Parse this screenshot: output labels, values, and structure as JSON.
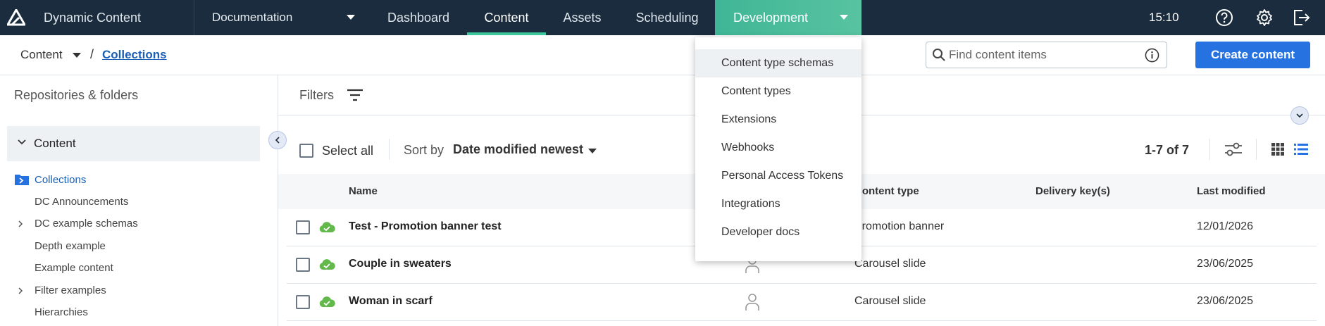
{
  "app": {
    "title": "Dynamic Content",
    "hub": "Documentation",
    "time": "15:10"
  },
  "nav": {
    "tabs": [
      {
        "label": "Dashboard"
      },
      {
        "label": "Content"
      },
      {
        "label": "Assets"
      },
      {
        "label": "Scheduling"
      }
    ],
    "active": "Content",
    "development": "Development"
  },
  "development_menu": {
    "items": [
      {
        "label": "Content type schemas"
      },
      {
        "label": "Content types"
      },
      {
        "label": "Extensions"
      },
      {
        "label": "Webhooks"
      },
      {
        "label": "Personal Access Tokens"
      },
      {
        "label": "Integrations"
      },
      {
        "label": "Developer docs"
      }
    ],
    "highlighted": "Content type schemas"
  },
  "breadcrumb": {
    "root": "Content",
    "separator": "/",
    "current": "Collections"
  },
  "search": {
    "placeholder": "Find content items"
  },
  "create_button": "Create content",
  "sidebar": {
    "title": "Repositories & folders",
    "repository": "Content",
    "tree": [
      {
        "label": "Collections",
        "expandable": false,
        "selected": true
      },
      {
        "label": "DC Announcements",
        "expandable": false
      },
      {
        "label": "DC example schemas",
        "expandable": true
      },
      {
        "label": "Depth example",
        "expandable": false
      },
      {
        "label": "Example content",
        "expandable": false
      },
      {
        "label": "Filter examples",
        "expandable": true
      },
      {
        "label": "Hierarchies",
        "expandable": false
      }
    ]
  },
  "filters": {
    "label": "Filters"
  },
  "toolbar": {
    "select_all": "Select all",
    "sort_label": "Sort by",
    "sort_value": "Date modified newest",
    "paging": "1-7 of 7"
  },
  "table": {
    "columns": {
      "name": "Name",
      "content_type": "Content type",
      "delivery_keys": "Delivery key(s)",
      "last_modified": "Last modified"
    },
    "rows": [
      {
        "name": "Test - Promotion banner test",
        "content_type": "Promotion banner",
        "delivery_key": "",
        "last_modified": "12/01/2026"
      },
      {
        "name": "Couple in sweaters",
        "content_type": "Carousel slide",
        "delivery_key": "",
        "last_modified": "23/06/2025"
      },
      {
        "name": "Woman in scarf",
        "content_type": "Carousel slide",
        "delivery_key": "",
        "last_modified": "23/06/2025"
      }
    ]
  },
  "colors": {
    "topbar": "#1a2c3d",
    "accent_green": "#3ec79c",
    "primary_blue": "#2672e0",
    "link_blue": "#1a5fb4",
    "status_cloud": "#62b84a"
  }
}
